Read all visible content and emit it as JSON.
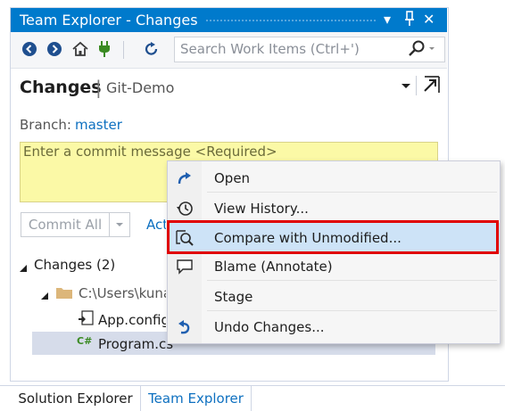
{
  "window": {
    "title": "Team Explorer - Changes",
    "buttons": {
      "dropdown": "▾",
      "pin": "🖈",
      "close": "✕"
    }
  },
  "toolbar": {
    "search_placeholder": "Search Work Items (Ctrl+')",
    "icons": [
      "back-icon",
      "forward-icon",
      "home-icon",
      "connect-icon",
      "refresh-icon",
      "search-icon"
    ]
  },
  "changes_page": {
    "title": "Changes",
    "separator": "|",
    "repo": "Git-Demo",
    "branch_label": "Branch:",
    "branch": "master",
    "commit_placeholder": "Enter a commit message <Required>",
    "commit_button": "Commit All",
    "actions_link": "Actions"
  },
  "tree": {
    "group_label": "Changes (2)",
    "folder": "C:\\Users\\kunal",
    "files": [
      "App.config",
      "Program.cs"
    ]
  },
  "context_menu": {
    "items": [
      {
        "label": "Open",
        "icon": "open-icon"
      },
      {
        "label": "View History...",
        "icon": "history-icon"
      },
      {
        "label": "Compare with Unmodified...",
        "icon": "compare-icon",
        "highlighted": true
      },
      {
        "label": "Blame (Annotate)",
        "icon": "blame-icon"
      },
      {
        "label": "Stage",
        "icon": ""
      },
      {
        "label": "Undo Changes...",
        "icon": "undo-icon"
      }
    ]
  },
  "bottom_tabs": [
    "Solution Explorer",
    "Team Explorer"
  ],
  "colors": {
    "titlebar": "#007acc",
    "link": "#0e70c0",
    "commit_box": "#fbf9a6",
    "highlight": "#cde3f7",
    "annotation_box": "#e00000"
  }
}
